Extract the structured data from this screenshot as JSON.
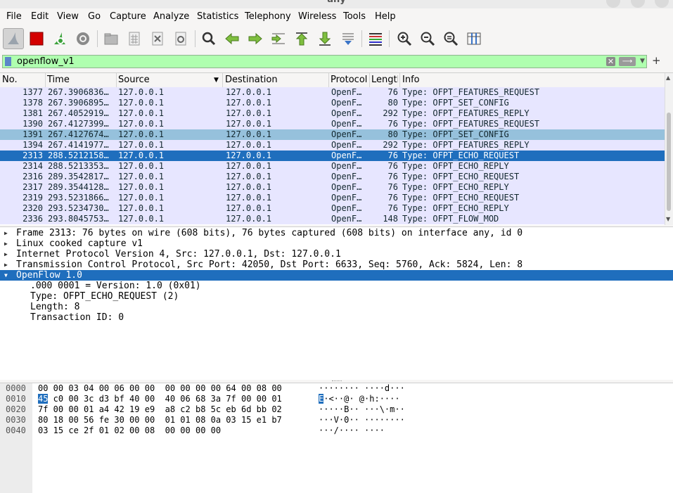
{
  "window": {
    "title": "any"
  },
  "menu": [
    "File",
    "Edit",
    "View",
    "Go",
    "Capture",
    "Analyze",
    "Statistics",
    "Telephony",
    "Wireless",
    "Tools",
    "Help"
  ],
  "filter": {
    "value": "openflow_v1",
    "clear_glyph": "✕",
    "apply_glyph": "⟶",
    "dropdown_glyph": "▼",
    "add_glyph": "+"
  },
  "columns": {
    "no": "No.",
    "time": "Time",
    "source": "Source",
    "destination": "Destination",
    "protocol": "Protocol",
    "length": "Length",
    "info": "Info"
  },
  "packets": [
    {
      "no": "1377",
      "time": "267.3906836…",
      "src": "127.0.0.1",
      "dst": "127.0.0.1",
      "proto": "OpenF…",
      "len": "76",
      "info": "Type: OFPT_FEATURES_REQUEST",
      "state": "normal"
    },
    {
      "no": "1378",
      "time": "267.3906895…",
      "src": "127.0.0.1",
      "dst": "127.0.0.1",
      "proto": "OpenF…",
      "len": "80",
      "info": "Type: OFPT_SET_CONFIG",
      "state": "normal"
    },
    {
      "no": "1381",
      "time": "267.4052919…",
      "src": "127.0.0.1",
      "dst": "127.0.0.1",
      "proto": "OpenF…",
      "len": "292",
      "info": "Type: OFPT_FEATURES_REPLY",
      "state": "normal"
    },
    {
      "no": "1390",
      "time": "267.4127399…",
      "src": "127.0.0.1",
      "dst": "127.0.0.1",
      "proto": "OpenF…",
      "len": "76",
      "info": "Type: OFPT_FEATURES_REQUEST",
      "state": "normal"
    },
    {
      "no": "1391",
      "time": "267.4127674…",
      "src": "127.0.0.1",
      "dst": "127.0.0.1",
      "proto": "OpenF…",
      "len": "80",
      "info": "Type: OFPT_SET_CONFIG",
      "state": "related"
    },
    {
      "no": "1394",
      "time": "267.4141977…",
      "src": "127.0.0.1",
      "dst": "127.0.0.1",
      "proto": "OpenF…",
      "len": "292",
      "info": "Type: OFPT_FEATURES_REPLY",
      "state": "normal"
    },
    {
      "no": "2313",
      "time": "288.5212158…",
      "src": "127.0.0.1",
      "dst": "127.0.0.1",
      "proto": "OpenF…",
      "len": "76",
      "info": "Type: OFPT_ECHO_REQUEST",
      "state": "selected"
    },
    {
      "no": "2314",
      "time": "288.5213353…",
      "src": "127.0.0.1",
      "dst": "127.0.0.1",
      "proto": "OpenF…",
      "len": "76",
      "info": "Type: OFPT_ECHO_REPLY",
      "state": "normal"
    },
    {
      "no": "2316",
      "time": "289.3542817…",
      "src": "127.0.0.1",
      "dst": "127.0.0.1",
      "proto": "OpenF…",
      "len": "76",
      "info": "Type: OFPT_ECHO_REQUEST",
      "state": "normal"
    },
    {
      "no": "2317",
      "time": "289.3544128…",
      "src": "127.0.0.1",
      "dst": "127.0.0.1",
      "proto": "OpenF…",
      "len": "76",
      "info": "Type: OFPT_ECHO_REPLY",
      "state": "normal"
    },
    {
      "no": "2319",
      "time": "293.5231866…",
      "src": "127.0.0.1",
      "dst": "127.0.0.1",
      "proto": "OpenF…",
      "len": "76",
      "info": "Type: OFPT_ECHO_REQUEST",
      "state": "normal"
    },
    {
      "no": "2320",
      "time": "293.5234730…",
      "src": "127.0.0.1",
      "dst": "127.0.0.1",
      "proto": "OpenF…",
      "len": "76",
      "info": "Type: OFPT_ECHO_REPLY",
      "state": "normal"
    },
    {
      "no": "2336",
      "time": "293.8045753…",
      "src": "127.0.0.1",
      "dst": "127.0.0.1",
      "proto": "OpenF…",
      "len": "148",
      "info": "Type: OFPT_FLOW_MOD",
      "state": "normal"
    }
  ],
  "details": {
    "frame": "Frame 2313: 76 bytes on wire (608 bits), 76 bytes captured (608 bits) on interface any, id 0",
    "linux": "Linux cooked capture v1",
    "ip": "Internet Protocol Version 4, Src: 127.0.0.1, Dst: 127.0.0.1",
    "tcp": "Transmission Control Protocol, Src Port: 42050, Dst Port: 6633, Seq: 5760, Ack: 5824, Len: 8",
    "openflow": "OpenFlow 1.0",
    "version": ".000 0001 = Version: 1.0 (0x01)",
    "type": "Type: OFPT_ECHO_REQUEST (2)",
    "length": "Length: 8",
    "xid": "Transaction ID: 0"
  },
  "bytes": {
    "rows": [
      {
        "off": "0000",
        "hex": "00 00 03 04 00 06 00 00  00 00 00 00 64 00 08 00",
        "ascii": "········ ····d···"
      },
      {
        "off": "0010",
        "hex_hl": "45",
        "hex_rest": " c0 00 3c d3 bf 40 00  40 06 68 3a 7f 00 00 01",
        "ascii_hl": "E",
        "ascii_rest": "·<··@· @·h:····"
      },
      {
        "off": "0020",
        "hex": "7f 00 00 01 a4 42 19 e9  a8 c2 b8 5c eb 6d bb 02",
        "ascii": "·····B·· ···\\·m··"
      },
      {
        "off": "0030",
        "hex": "80 18 00 56 fe 30 00 00  01 01 08 0a 03 15 e1 b7",
        "ascii": "···V·0·· ········"
      },
      {
        "off": "0040",
        "hex": "03 15 ce 2f 01 02 00 08  00 00 00 00",
        "ascii": "···/···· ····"
      }
    ]
  },
  "colors": {
    "row_bg": "#e7e6ff",
    "selected": "#1f6ebd",
    "related": "#96c1dc",
    "filter_ok": "#afffaf"
  }
}
